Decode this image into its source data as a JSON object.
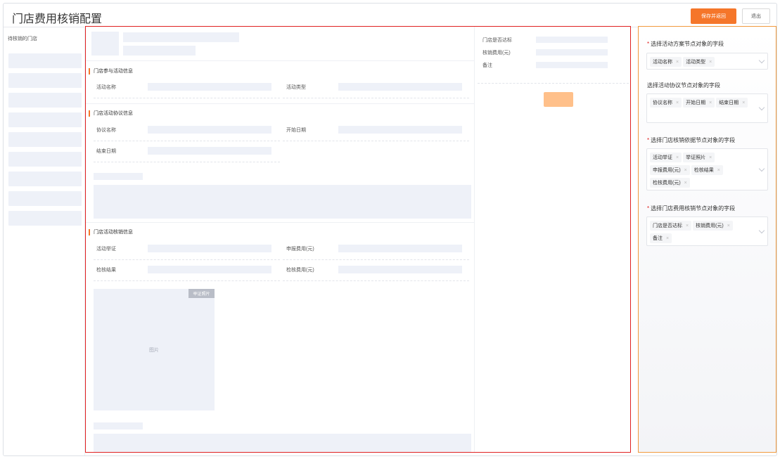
{
  "header": {
    "title": "门店费用核销配置",
    "save_label": "保存并返回",
    "exit_label": "退出"
  },
  "sidebar": {
    "title": "待核销的门店"
  },
  "sections": {
    "participation": {
      "title": "门店参与活动信息",
      "fields": [
        "活动名称",
        "活动类型"
      ]
    },
    "agreement": {
      "title": "门店活动协议信息",
      "fields": [
        "协议名称",
        "开始日期",
        "结束日期"
      ]
    },
    "verification": {
      "title": "门店活动核销信息",
      "fields": [
        "活动举证",
        "申报费用(元)",
        "检核结果",
        "检核费用(元)"
      ]
    }
  },
  "photo": {
    "badge": "举证照片",
    "label": "图片"
  },
  "right_panel": {
    "fields": [
      "门店是否达标",
      "核销费用(元)",
      "备注"
    ]
  },
  "config": {
    "groups": [
      {
        "label": "选择活动方案节点对象的字段",
        "required": true,
        "tags": [
          "活动名称",
          "活动类型"
        ]
      },
      {
        "label": "选择活动协议节点对象的字段",
        "required": false,
        "tags": [
          "协议名称",
          "开始日期",
          "结束日期"
        ]
      },
      {
        "label": "选择门店核销依据节点对象的字段",
        "required": true,
        "tags": [
          "活动举证",
          "举证照片",
          "申报费用(元)",
          "检核结果",
          "检核费用(元)"
        ]
      },
      {
        "label": "选择门店费用核销节点对象的字段",
        "required": true,
        "tags": [
          "门店是否达标",
          "核销费用(元)",
          "备注"
        ]
      }
    ]
  },
  "colors": {
    "accent": "#f5762a",
    "main_outline": "#e02020",
    "config_outline": "#f19a3d",
    "placeholder": "#eef1f8"
  }
}
